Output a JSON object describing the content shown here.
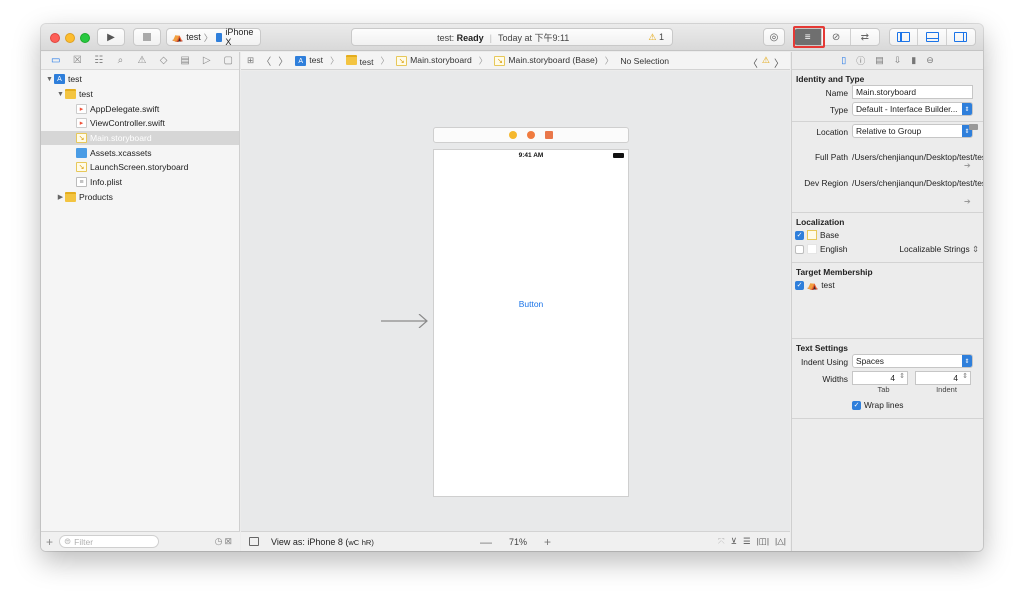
{
  "toolbar": {
    "scheme_project": "test",
    "scheme_device": "iPhone X",
    "activity_status_prefix": "test: ",
    "activity_status": "Ready",
    "activity_time": "Today at 下午9:11",
    "warning_count": "1",
    "accent": "#1b74e8",
    "highlight_color": "#e53935"
  },
  "navigator": {
    "items": [
      {
        "label": "test",
        "icon": "project-icon",
        "level": 0,
        "disclosure": "▼"
      },
      {
        "label": "test",
        "icon": "folder-icon",
        "level": 1,
        "disclosure": "▼"
      },
      {
        "label": "AppDelegate.swift",
        "icon": "swift-file-icon",
        "level": 2,
        "disclosure": ""
      },
      {
        "label": "ViewController.swift",
        "icon": "swift-file-icon",
        "level": 2,
        "disclosure": ""
      },
      {
        "label": "Main.storyboard",
        "icon": "storyboard-icon",
        "level": 2,
        "disclosure": "",
        "selected": true
      },
      {
        "label": "Assets.xcassets",
        "icon": "assets-folder-icon",
        "level": 2,
        "disclosure": ""
      },
      {
        "label": "LaunchScreen.storyboard",
        "icon": "storyboard-icon",
        "level": 2,
        "disclosure": ""
      },
      {
        "label": "Info.plist",
        "icon": "plist-icon",
        "level": 2,
        "disclosure": ""
      },
      {
        "label": "Products",
        "icon": "folder-icon",
        "level": 1,
        "disclosure": "▶"
      }
    ],
    "filter_placeholder": "Filter"
  },
  "jumpbar": {
    "crumbs": [
      "test",
      "test",
      "Main.storyboard",
      "Main.storyboard (Base)",
      "No Selection"
    ]
  },
  "canvas": {
    "phone_time": "9:41 AM",
    "button_label": "Button"
  },
  "editor_footer": {
    "view_as": "View as: iPhone 8 (",
    "view_as_w": "wC",
    "view_as_h": "hR)",
    "zoom_minus": "—",
    "zoom": "71%",
    "zoom_plus": "+"
  },
  "inspector": {
    "identity_title": "Identity and Type",
    "name_label": "Name",
    "name_value": "Main.storyboard",
    "type_label": "Type",
    "type_value": "Default - Interface Builder...",
    "location_label": "Location",
    "location_value": "Relative to Group",
    "fullpath_label": "Full Path",
    "fullpath_value": "/Users/chenjianqun/Desktop/test/test",
    "devregion_label": "Dev Region",
    "devregion_value": "/Users/chenjianqun/Desktop/test/test/Base.lproj/Main.storyboard",
    "localization_title": "Localization",
    "loc_base": "Base",
    "loc_english": "English",
    "loc_english_type": "Localizable Strings",
    "target_title": "Target Membership",
    "target_name": "test",
    "text_settings_title": "Text Settings",
    "indent_using_label": "Indent Using",
    "indent_using_value": "Spaces",
    "widths_label": "Widths",
    "tab_width": "4",
    "indent_width": "4",
    "tab_label": "Tab",
    "indent_label": "Indent",
    "wrap_lines": "Wrap lines"
  }
}
